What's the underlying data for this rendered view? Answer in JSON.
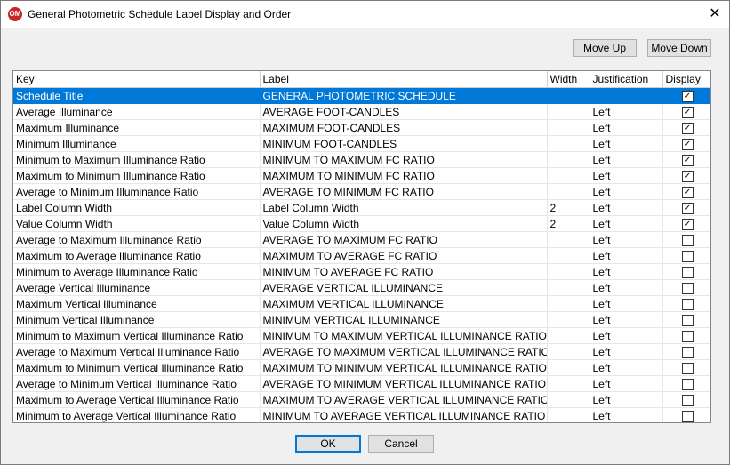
{
  "window": {
    "title": "General Photometric Schedule Label Display and Order",
    "app_icon_text": "OM",
    "close_symbol": "✕"
  },
  "buttons": {
    "move_up": "Move Up",
    "move_down": "Move Down",
    "ok": "OK",
    "cancel": "Cancel"
  },
  "table": {
    "headers": {
      "key": "Key",
      "label": "Label",
      "width": "Width",
      "justification": "Justification",
      "display": "Display"
    },
    "rows": [
      {
        "key": "Schedule Title",
        "label": "GENERAL PHOTOMETRIC SCHEDULE",
        "width": "",
        "justification": "",
        "display": true,
        "selected": true
      },
      {
        "key": "Average Illuminance",
        "label": "AVERAGE FOOT-CANDLES",
        "width": "",
        "justification": "Left",
        "display": true
      },
      {
        "key": "Maximum Illuminance",
        "label": "MAXIMUM FOOT-CANDLES",
        "width": "",
        "justification": "Left",
        "display": true
      },
      {
        "key": "Minimum Illuminance",
        "label": "MINIMUM FOOT-CANDLES",
        "width": "",
        "justification": "Left",
        "display": true
      },
      {
        "key": "Minimum to Maximum Illuminance Ratio",
        "label": "MINIMUM TO MAXIMUM FC RATIO",
        "width": "",
        "justification": "Left",
        "display": true
      },
      {
        "key": "Maximum to Minimum Illuminance Ratio",
        "label": "MAXIMUM TO MINIMUM FC RATIO",
        "width": "",
        "justification": "Left",
        "display": true
      },
      {
        "key": "Average to Minimum Illuminance Ratio",
        "label": "AVERAGE TO MINIMUM FC RATIO",
        "width": "",
        "justification": "Left",
        "display": true
      },
      {
        "key": "Label Column Width",
        "label": "Label Column Width",
        "width": "2",
        "justification": "Left",
        "display": true
      },
      {
        "key": "Value Column Width",
        "label": "Value Column Width",
        "width": "2",
        "justification": "Left",
        "display": true
      },
      {
        "key": "Average to Maximum Illuminance Ratio",
        "label": "AVERAGE TO MAXIMUM FC RATIO",
        "width": "",
        "justification": "Left",
        "display": false
      },
      {
        "key": "Maximum to Average Illuminance Ratio",
        "label": "MAXIMUM TO AVERAGE FC RATIO",
        "width": "",
        "justification": "Left",
        "display": false
      },
      {
        "key": "Minimum to Average Illuminance Ratio",
        "label": "MINIMUM TO AVERAGE FC RATIO",
        "width": "",
        "justification": "Left",
        "display": false
      },
      {
        "key": "Average Vertical Illuminance",
        "label": "AVERAGE VERTICAL ILLUMINANCE",
        "width": "",
        "justification": "Left",
        "display": false
      },
      {
        "key": "Maximum Vertical Illuminance",
        "label": "MAXIMUM VERTICAL ILLUMINANCE",
        "width": "",
        "justification": "Left",
        "display": false
      },
      {
        "key": "Minimum Vertical Illuminance",
        "label": "MINIMUM VERTICAL ILLUMINANCE",
        "width": "",
        "justification": "Left",
        "display": false
      },
      {
        "key": "Minimum to Maximum Vertical Illuminance Ratio",
        "label": "MINIMUM TO MAXIMUM VERTICAL ILLUMINANCE RATIO",
        "width": "",
        "justification": "Left",
        "display": false
      },
      {
        "key": "Average to Maximum Vertical Illuminance Ratio",
        "label": "AVERAGE TO MAXIMUM VERTICAL ILLUMINANCE RATIO",
        "width": "",
        "justification": "Left",
        "display": false
      },
      {
        "key": "Maximum to Minimum Vertical Illuminance Ratio",
        "label": "MAXIMUM TO MINIMUM VERTICAL ILLUMINANCE RATIO",
        "width": "",
        "justification": "Left",
        "display": false
      },
      {
        "key": "Average to Minimum Vertical Illuminance Ratio",
        "label": "AVERAGE TO MINIMUM VERTICAL ILLUMINANCE RATIO",
        "width": "",
        "justification": "Left",
        "display": false
      },
      {
        "key": "Maximum to Average Vertical Illuminance Ratio",
        "label": "MAXIMUM TO AVERAGE VERTICAL ILLUMINANCE RATIO",
        "width": "",
        "justification": "Left",
        "display": false
      },
      {
        "key": "Minimum to Average Vertical Illuminance Ratio",
        "label": "MINIMUM TO AVERAGE VERTICAL ILLUMINANCE RATIO",
        "width": "",
        "justification": "Left",
        "display": false
      }
    ]
  },
  "colors": {
    "selection": "#0078d7",
    "window_bg": "#f0f0f0"
  },
  "checkbox_checked_symbol": "✓"
}
